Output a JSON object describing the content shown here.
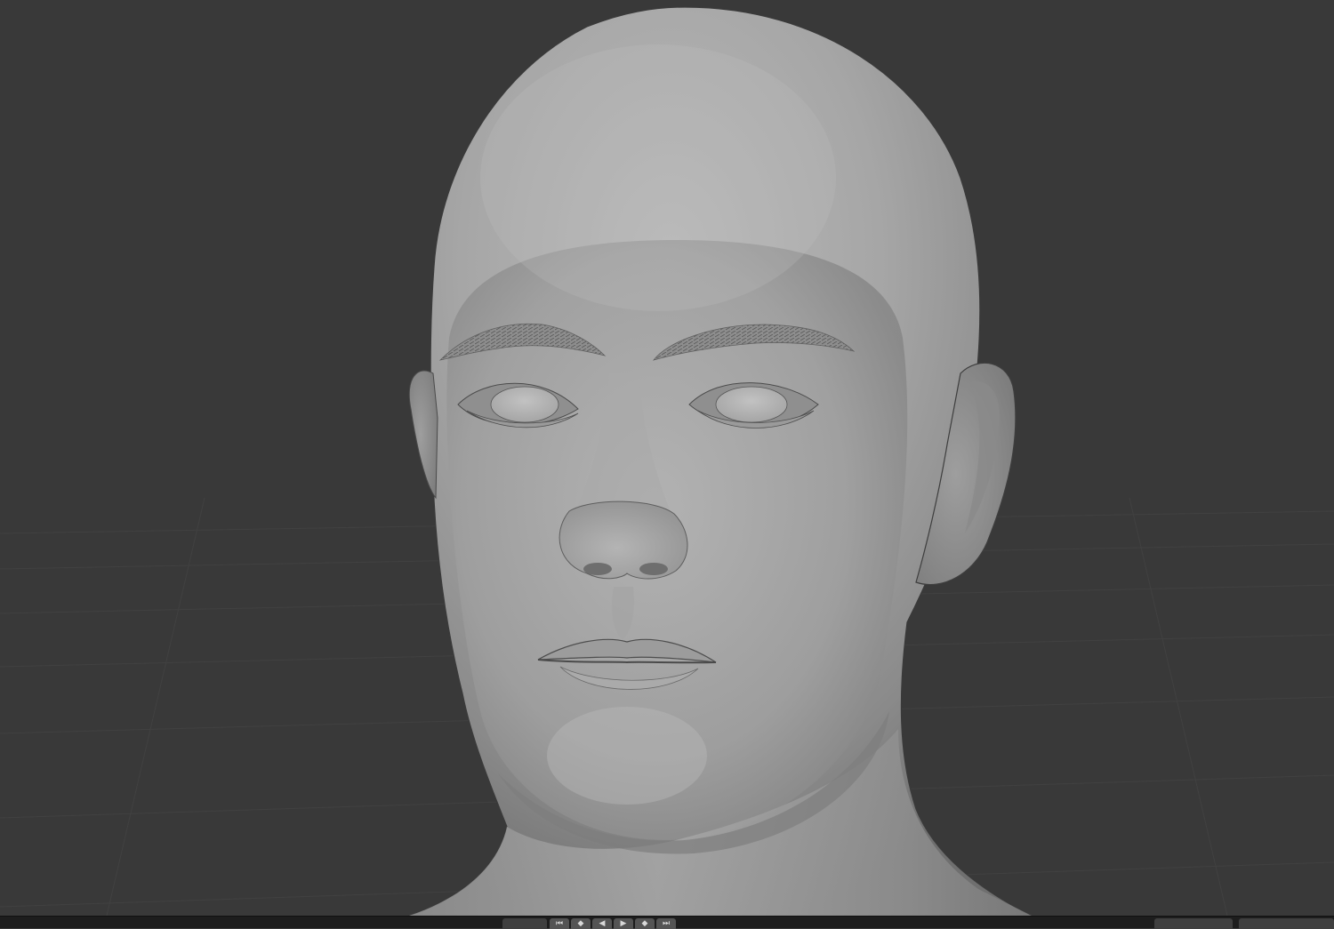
{
  "window": {
    "background": "#393939",
    "timeline_background": "#1d1d1d"
  },
  "viewport": {
    "content": "sculpted-head-mesh",
    "shading": "solid"
  },
  "timeline": {
    "controls": [
      {
        "name": "jump-start-icon",
        "glyph": "⏮"
      },
      {
        "name": "prev-keyframe-icon",
        "glyph": "◆"
      },
      {
        "name": "play-reverse-icon",
        "glyph": "◀"
      },
      {
        "name": "play-icon",
        "glyph": "▶"
      },
      {
        "name": "next-keyframe-icon",
        "glyph": "◆"
      },
      {
        "name": "jump-end-icon",
        "glyph": "⏭"
      }
    ]
  }
}
